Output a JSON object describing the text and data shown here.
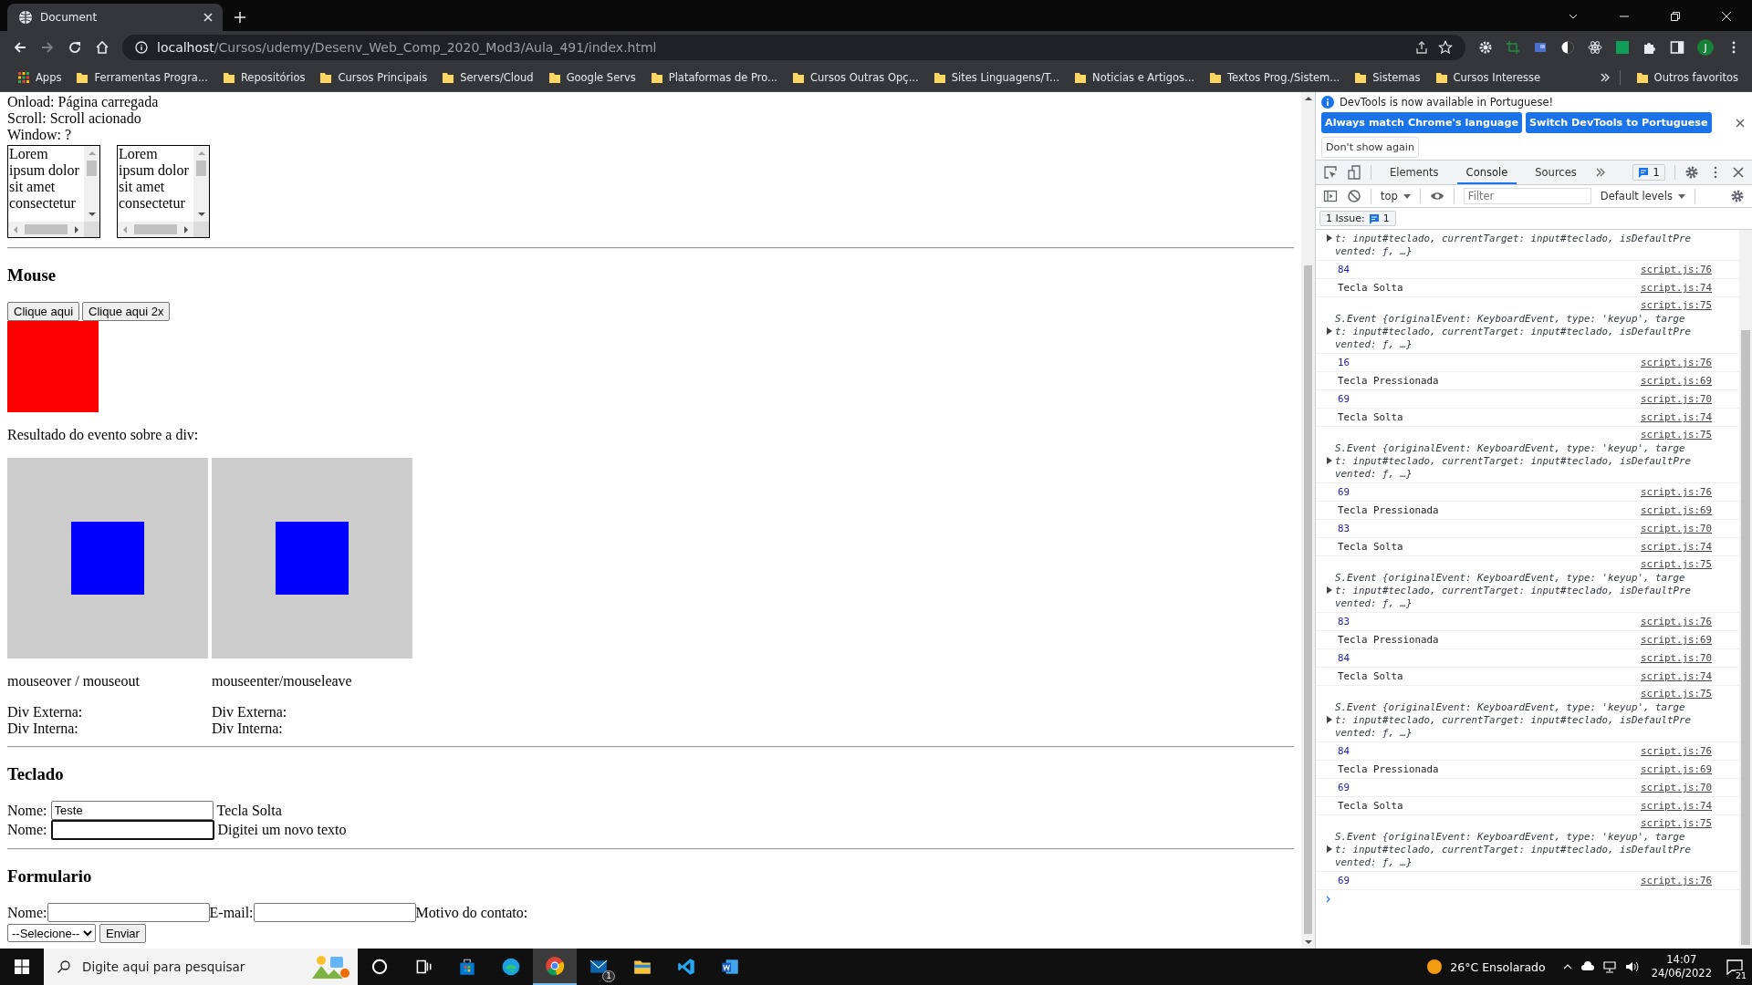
{
  "browser": {
    "tab": {
      "title": "Document"
    },
    "url": {
      "host": "localhost",
      "path": "/Cursos/udemy/Desenv_Web_Comp_2020_Mod3/Aula_491/index.html"
    },
    "profile_initial": "J",
    "bookmarks": [
      {
        "label": "Apps",
        "kind": "apps"
      },
      {
        "label": "Ferramentas Progra...",
        "kind": "folder"
      },
      {
        "label": "Repositórios",
        "kind": "folder"
      },
      {
        "label": "Cursos Principais",
        "kind": "folder"
      },
      {
        "label": "Servers/Cloud",
        "kind": "folder"
      },
      {
        "label": "Google Servs",
        "kind": "folder"
      },
      {
        "label": "Plataformas de Pro...",
        "kind": "folder"
      },
      {
        "label": "Cursos Outras Opç...",
        "kind": "folder"
      },
      {
        "label": "Sites Linguagens/T...",
        "kind": "folder"
      },
      {
        "label": "Noticias e Artigos...",
        "kind": "folder"
      },
      {
        "label": "Textos Prog./Sistem...",
        "kind": "folder"
      },
      {
        "label": "Sistemas",
        "kind": "folder"
      },
      {
        "label": "Cursos Interesse",
        "kind": "folder"
      }
    ],
    "other_bookmarks": "Outros favoritos"
  },
  "page": {
    "status_lines": [
      "Onload: Página carregada",
      "Scroll: Scroll acionado",
      "Window: ?"
    ],
    "scroll_boxes": [
      {
        "text": "Lorem ipsum dolor sit amet consectetur"
      },
      {
        "text": "Lorem ipsum dolor sit amet consectetur"
      }
    ],
    "mouse": {
      "heading": "Mouse",
      "buttons": [
        "Clique aqui",
        "Clique aqui 2x"
      ],
      "result_label": "Resultado do evento sobre a div:",
      "demos": [
        {
          "caption": "mouseover / mouseout",
          "outer": "Div Externa:",
          "inner": "Div Interna:"
        },
        {
          "caption": "mouseenter/mouseleave",
          "outer": "Div Externa:",
          "inner": "Div Interna:"
        }
      ]
    },
    "keyboard": {
      "heading": "Teclado",
      "rows": [
        {
          "label": "Nome:",
          "value": "Teste",
          "focused": false,
          "status": "Tecla Solta"
        },
        {
          "label": "Nome:",
          "focused": true,
          "status": "Digitei um novo texto"
        }
      ]
    },
    "form": {
      "heading": "Formulario",
      "name_label": "Nome:",
      "email_label": "E-mail:",
      "reason_label": "Motivo do contato:",
      "select": "--Selecione--",
      "submit": "Enviar"
    }
  },
  "devtools": {
    "notice": {
      "message": "DevTools is now available in Portuguese!",
      "actions": [
        "Always match Chrome's language",
        "Switch DevTools to Portuguese"
      ],
      "dismiss": "Don't show again"
    },
    "tabs": [
      {
        "label": "Elements",
        "selected": false
      },
      {
        "label": "Console",
        "selected": true
      },
      {
        "label": "Sources",
        "selected": false
      }
    ],
    "issues_badge": "1",
    "toolbar": {
      "context": "top",
      "filter_placeholder": "Filter",
      "levels": "Default levels"
    },
    "issues": {
      "label": "1 Issue:",
      "count": "1"
    },
    "console": [
      {
        "kind": "event",
        "lines": [
          "t: input#teclado, currentTarget: input#teclado, isDefaultPre",
          "vented: ƒ, …}"
        ]
      },
      {
        "kind": "number",
        "text": "84",
        "source": "script.js:76"
      },
      {
        "kind": "log",
        "text": "Tecla Solta",
        "source": "script.js:74"
      },
      {
        "kind": "event",
        "source": "script.js:75",
        "lines": [
          "S.Event {originalEvent: KeyboardEvent, type: 'keyup', targe",
          "t: input#teclado, currentTarget: input#teclado, isDefaultPre",
          "vented: ƒ, …}"
        ]
      },
      {
        "kind": "number",
        "text": "16",
        "source": "script.js:76"
      },
      {
        "kind": "log",
        "text": "Tecla Pressionada",
        "source": "script.js:69"
      },
      {
        "kind": "number",
        "text": "69",
        "source": "script.js:70"
      },
      {
        "kind": "log",
        "text": "Tecla Solta",
        "source": "script.js:74"
      },
      {
        "kind": "event",
        "source": "script.js:75",
        "lines": [
          "S.Event {originalEvent: KeyboardEvent, type: 'keyup', targe",
          "t: input#teclado, currentTarget: input#teclado, isDefaultPre",
          "vented: ƒ, …}"
        ]
      },
      {
        "kind": "number",
        "text": "69",
        "source": "script.js:76"
      },
      {
        "kind": "log",
        "text": "Tecla Pressionada",
        "source": "script.js:69"
      },
      {
        "kind": "number",
        "text": "83",
        "source": "script.js:70"
      },
      {
        "kind": "log",
        "text": "Tecla Solta",
        "source": "script.js:74"
      },
      {
        "kind": "event",
        "source": "script.js:75",
        "lines": [
          "S.Event {originalEvent: KeyboardEvent, type: 'keyup', targe",
          "t: input#teclado, currentTarget: input#teclado, isDefaultPre",
          "vented: ƒ, …}"
        ]
      },
      {
        "kind": "number",
        "text": "83",
        "source": "script.js:76"
      },
      {
        "kind": "log",
        "text": "Tecla Pressionada",
        "source": "script.js:69"
      },
      {
        "kind": "number",
        "text": "84",
        "source": "script.js:70"
      },
      {
        "kind": "log",
        "text": "Tecla Solta",
        "source": "script.js:74"
      },
      {
        "kind": "event",
        "source": "script.js:75",
        "lines": [
          "S.Event {originalEvent: KeyboardEvent, type: 'keyup', targe",
          "t: input#teclado, currentTarget: input#teclado, isDefaultPre",
          "vented: ƒ, …}"
        ]
      },
      {
        "kind": "number",
        "text": "84",
        "source": "script.js:76"
      },
      {
        "kind": "log",
        "text": "Tecla Pressionada",
        "source": "script.js:69"
      },
      {
        "kind": "number",
        "text": "69",
        "source": "script.js:70"
      },
      {
        "kind": "log",
        "text": "Tecla Solta",
        "source": "script.js:74"
      },
      {
        "kind": "event",
        "source": "script.js:75",
        "lines": [
          "S.Event {originalEvent: KeyboardEvent, type: 'keyup', targe",
          "t: input#teclado, currentTarget: input#teclado, isDefaultPre",
          "vented: ƒ, …}"
        ]
      },
      {
        "kind": "number",
        "text": "69",
        "source": "script.js:76"
      }
    ]
  },
  "taskbar": {
    "search_placeholder": "Digite aqui para pesquisar",
    "apps": [
      {
        "selected": false
      },
      {
        "selected": false
      },
      {
        "selected": false
      },
      {
        "selected": false
      },
      {
        "selected": true
      },
      {
        "selected": false,
        "badge": "1"
      },
      {
        "selected": false
      },
      {
        "selected": false
      },
      {
        "selected": false
      }
    ],
    "weather": "26°C Ensolarado",
    "time": "14:07",
    "date": "24/06/2022",
    "notifications": "21"
  }
}
